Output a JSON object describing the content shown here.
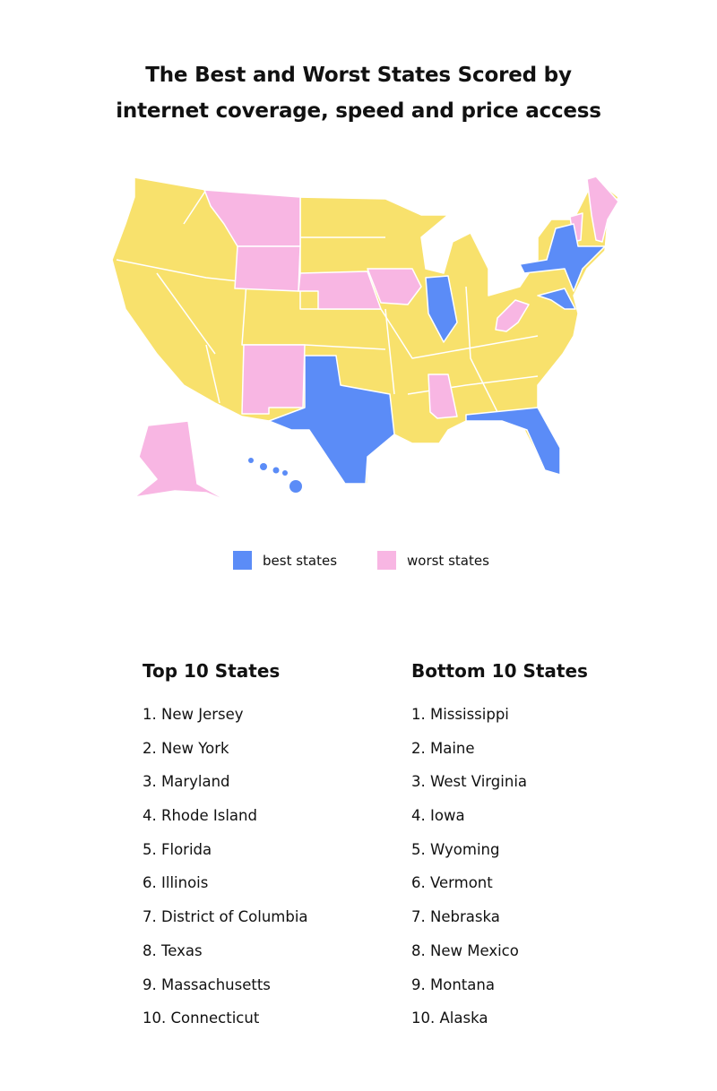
{
  "title": {
    "line1": "The Best and Worst States Scored by",
    "line2": "internet coverage, speed and price access"
  },
  "colors": {
    "best": "#5b8cf7",
    "worst": "#f8b6e3",
    "other": "#f8e16c"
  },
  "map": {
    "best_states": [
      "New Jersey",
      "New York",
      "Maryland",
      "Rhode Island",
      "Florida",
      "Illinois",
      "District of Columbia",
      "Texas",
      "Massachusetts",
      "Connecticut",
      "Hawaii"
    ],
    "worst_states": [
      "Mississippi",
      "Maine",
      "West Virginia",
      "Iowa",
      "Wyoming",
      "Vermont",
      "Nebraska",
      "New Mexico",
      "Montana",
      "Alaska"
    ]
  },
  "legend": {
    "best": "best states",
    "worst": "worst states"
  },
  "top": {
    "heading": "Top 10 States",
    "items": [
      "1. New Jersey",
      "2. New York",
      "3. Maryland",
      "4. Rhode Island",
      "5. Florida",
      "6. Illinois",
      "7. District of Columbia",
      "8. Texas",
      "9. Massachusetts",
      "10. Connecticut"
    ]
  },
  "bottom": {
    "heading": "Bottom 10 States",
    "items": [
      "1. Mississippi",
      "2. Maine",
      "3. West Virginia",
      "4. Iowa",
      "5. Wyoming",
      "6. Vermont",
      "7. Nebraska",
      "8. New Mexico",
      "9. Montana",
      "10. Alaska"
    ]
  }
}
